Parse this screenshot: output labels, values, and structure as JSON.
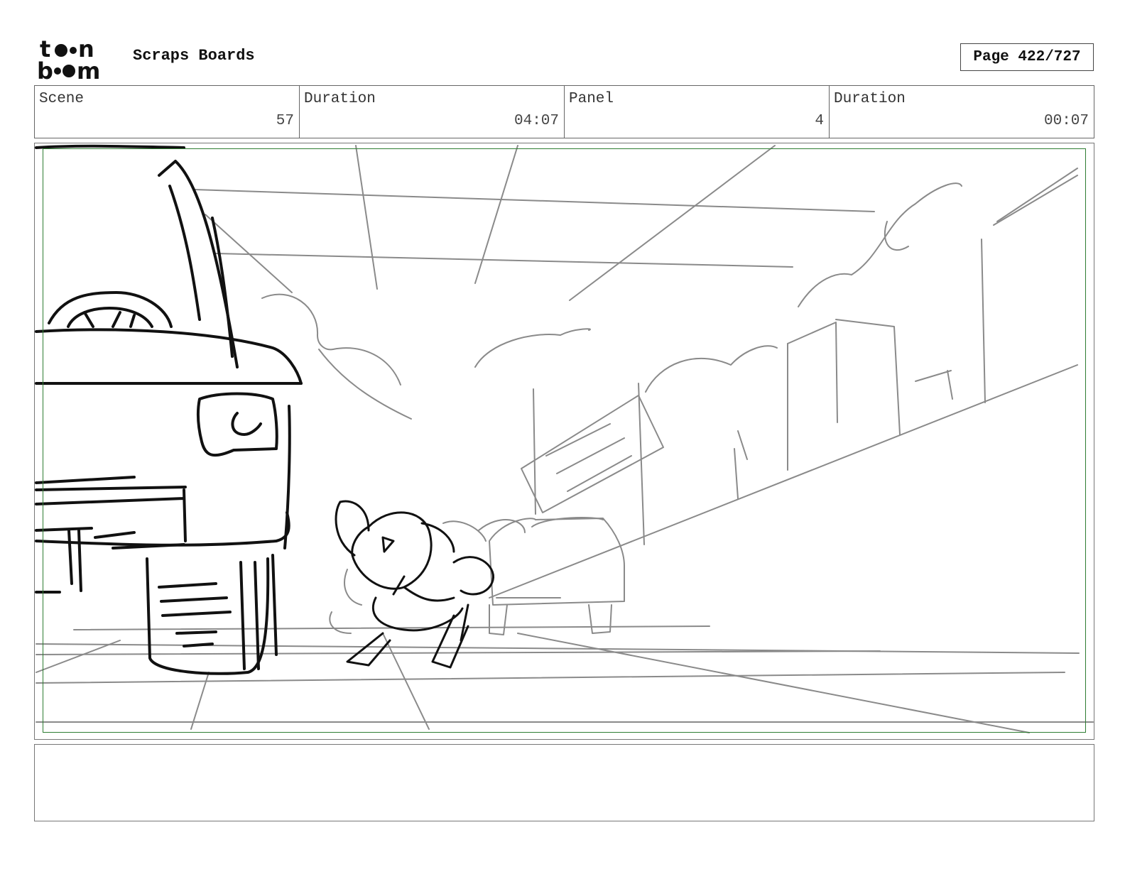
{
  "header": {
    "logo_text": "toonboom",
    "title": "Scraps Boards",
    "page_label": "Page 422/727"
  },
  "info": [
    {
      "label": "Scene",
      "value": "57"
    },
    {
      "label": "Duration",
      "value": "04:07"
    },
    {
      "label": "Panel",
      "value": "4"
    },
    {
      "label": "Duration",
      "value": "00:07"
    }
  ],
  "panel": {
    "image_name": "storyboard-sketch",
    "frame_color": "#2e7d32",
    "line_dark": "#111111",
    "line_light": "#8a8a8a"
  },
  "notes": {
    "text": ""
  }
}
